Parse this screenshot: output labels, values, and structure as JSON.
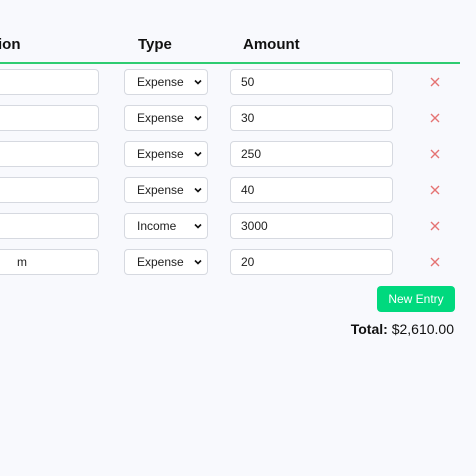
{
  "table": {
    "headers": {
      "description": "tion",
      "type": "Type",
      "amount": "Amount"
    },
    "rows": [
      {
        "description": "",
        "type": "Expense",
        "amount": "50"
      },
      {
        "description": "",
        "type": "Expense",
        "amount": "30"
      },
      {
        "description": "",
        "type": "Expense",
        "amount": "250"
      },
      {
        "description": "",
        "type": "Expense",
        "amount": "40"
      },
      {
        "description": "",
        "type": "Income",
        "amount": "3000"
      },
      {
        "description": "m",
        "type": "Expense",
        "amount": "20"
      }
    ]
  },
  "actions": {
    "new_entry_label": "New Entry"
  },
  "summary": {
    "total_label": "Total:",
    "total_value": "$2,610.00"
  },
  "icons": {
    "delete": "close-icon",
    "dropdown": "chevron-down-icon"
  },
  "colors": {
    "accent": "#2ecc71",
    "button": "#00d97e",
    "delete": "#e57373"
  }
}
